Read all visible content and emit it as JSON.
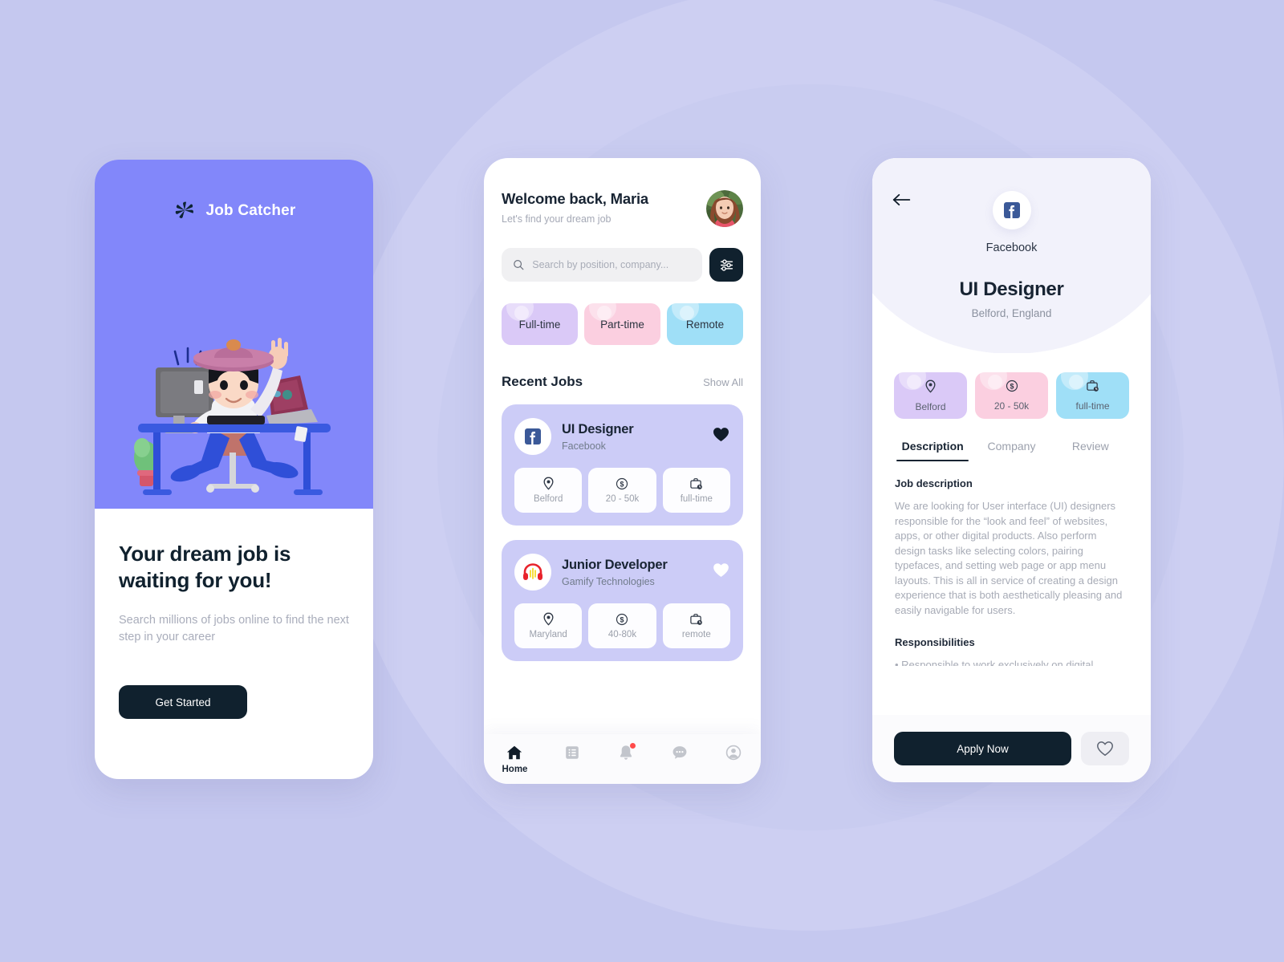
{
  "colors": {
    "page_background": "#c5c8ef",
    "brand_purple": "#8287fa",
    "dark": "#10212e",
    "card_lavender": "#ccccf7",
    "chip_purple": "#dac9f7",
    "chip_pink": "#fbcfe0",
    "chip_blue": "#9fdff7",
    "accent_red": "#ff4b4b"
  },
  "onboarding": {
    "brand_name": "Job Catcher",
    "logo_icon": "pinwheel-logo-icon",
    "illustration": "person-at-desk-3d-illustration",
    "headline": "Your dream job is waiting for you!",
    "subtext": "Search millions of jobs online to find the next step in your career",
    "cta_label": "Get Started"
  },
  "home": {
    "greeting": "Welcome back, Maria",
    "tagline": "Let's find your dream job",
    "avatar_alt": "user-profile-photo",
    "search": {
      "placeholder": "Search by position, company...",
      "value": "",
      "icon": "search-icon",
      "filter_icon": "sliders-filter-icon"
    },
    "chips": [
      {
        "label": "Full-time",
        "color": "#dac9f7"
      },
      {
        "label": "Part-time",
        "color": "#fbcfe0"
      },
      {
        "label": "Remote",
        "color": "#9fdff7"
      }
    ],
    "section": {
      "title": "Recent Jobs",
      "action": "Show All"
    },
    "jobs": [
      {
        "title": "UI Designer",
        "company": "Facebook",
        "logo": "facebook-icon",
        "favorited": true,
        "meta": [
          {
            "icon": "location-pin-icon",
            "label": "Belford"
          },
          {
            "icon": "dollar-coin-icon",
            "label": "20 - 50k"
          },
          {
            "icon": "briefcase-clock-icon",
            "label": "full-time"
          }
        ]
      },
      {
        "title": "Junior Developer",
        "company": "Gamify Technologies",
        "logo": "headphones-icon",
        "favorited": false,
        "meta": [
          {
            "icon": "location-pin-icon",
            "label": "Maryland"
          },
          {
            "icon": "dollar-coin-icon",
            "label": "40-80k"
          },
          {
            "icon": "briefcase-clock-icon",
            "label": "remote"
          }
        ]
      }
    ],
    "tabs": [
      {
        "icon": "home-icon",
        "label": "Home",
        "active": true,
        "badge": false
      },
      {
        "icon": "list-icon",
        "label": "",
        "active": false,
        "badge": false
      },
      {
        "icon": "bell-icon",
        "label": "",
        "active": false,
        "badge": true
      },
      {
        "icon": "chat-icon",
        "label": "",
        "active": false,
        "badge": false
      },
      {
        "icon": "profile-icon",
        "label": "",
        "active": false,
        "badge": false
      }
    ]
  },
  "detail": {
    "back_icon": "arrow-left-icon",
    "company_logo": "facebook-icon",
    "company": "Facebook",
    "role": "UI Designer",
    "location": "Belford, England",
    "pills": [
      {
        "icon": "location-pin-icon",
        "label": "Belford",
        "color": "#dac9f7"
      },
      {
        "icon": "dollar-coin-icon",
        "label": "20 - 50k",
        "color": "#fbcfe0"
      },
      {
        "icon": "briefcase-clock-icon",
        "label": "full-time",
        "color": "#9fdff7"
      }
    ],
    "tabs": [
      {
        "label": "Description",
        "active": true
      },
      {
        "label": "Company",
        "active": false
      },
      {
        "label": "Review",
        "active": false
      }
    ],
    "description_heading": "Job description",
    "description_body": "We are looking for User interface (UI) designers responsible for the “look and feel” of websites, apps, or other digital products. Also perform design tasks like selecting colors, pairing typefaces, and setting web page or app menu layouts. This is all in service of creating a design experience that is both aesthetically pleasing and easily navigable for users.",
    "responsibilities_heading": "Responsibilities",
    "responsibilities_first": "• Responsible to work exclusively on digital",
    "apply_label": "Apply Now",
    "favorite_icon": "heart-outline-icon"
  }
}
